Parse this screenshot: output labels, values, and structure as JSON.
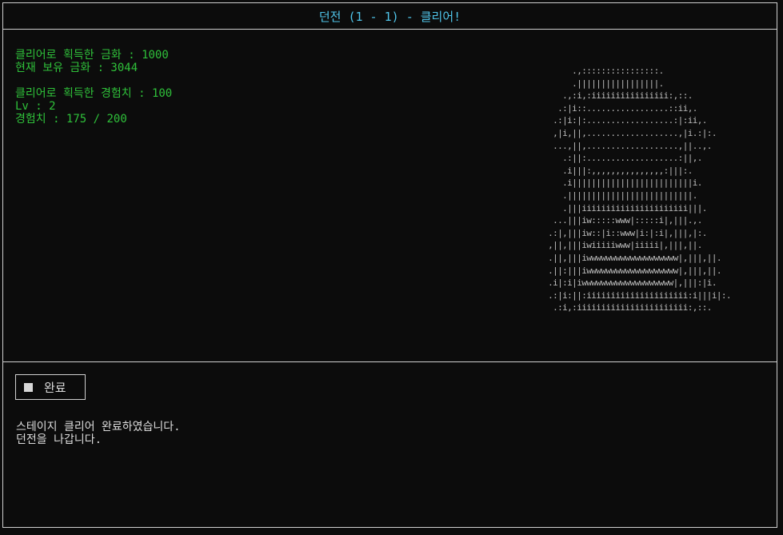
{
  "title": "던전 (1 - 1) - 클리어!",
  "stats": {
    "gold_earned": "클리어로 획득한 금화 : 1000",
    "gold_current": "현재 보유 금화 : 3044",
    "exp_earned": "클리어로 획득한 경험치 : 100",
    "level": "Lv : 2",
    "exp_progress": "경험치 : 175 / 200"
  },
  "ascii_art": "        .,::::::::::::::::.\n        .|||||||||||||||||.\n      .,:i,:iiiiiiiiiiiiiiii:,::.\n     .:|i::.................::ii,.\n    .:|i:|:..................:|:ii,.\n    ,|i,||,...................,|i.:|:.\n    ...,||,...................,||..,.\n      .:||:...................:||,.\n      .i|||:,,,,,,,,,,,,,,,:|||:.\n      .i|||||||||||||||||||||||||i.\n      .||||||||||||||||||||||||||.\n      .|||iiiiiiiiiiiiiiiiiiiiii|||.\n    ...|||iw:::::www|:::::i|,|||.,.\n   .:|,|||iw::|i::www|i:|:i|,|||,|:.\n   ,||,|||iwiiiiiwww|iiiii|,|||,||.\n   .||,|||iwwwwwwwwwwwwwwwwwww|,|||,||.\n   .||:|||iwwwwwwwwwwwwwwwwwww|,|||,||.\n   .i|:i|iwwwwwwwwwwwwwwwwwww|,|||:|i.\n   .:|i:||:iiiiiiiiiiiiiiiiiiiii:i|||i|:.\n    .:i,:iiiiiiiiiiiiiiiiiiiiiii:,::.",
  "bottom": {
    "button_label": "완료",
    "message_line1": "스테이지 클리어 완료하였습니다.",
    "message_line2": "던전을 나갑니다."
  }
}
